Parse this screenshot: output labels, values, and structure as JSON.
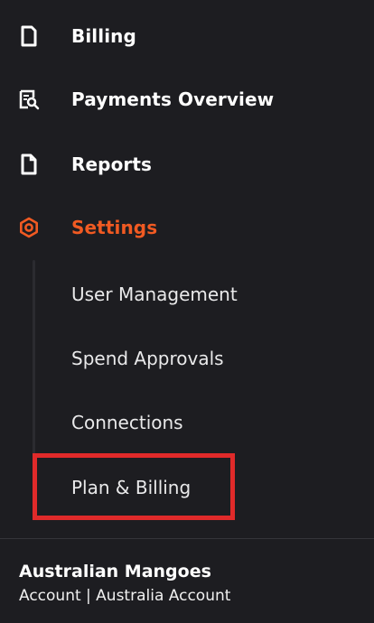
{
  "colors": {
    "background": "#1d1d21",
    "active_accent": "#f15a22",
    "highlight_box": "#e02a2a",
    "text": "#ffffff"
  },
  "nav": {
    "items": [
      {
        "label": "Billing",
        "icon": "document-icon",
        "active": false
      },
      {
        "label": "Payments Overview",
        "icon": "search-document-icon",
        "active": false
      },
      {
        "label": "Reports",
        "icon": "file-icon",
        "active": false
      },
      {
        "label": "Settings",
        "icon": "gear-icon",
        "active": true
      }
    ]
  },
  "settings_submenu": {
    "items": [
      {
        "label": "User Management"
      },
      {
        "label": "Spend Approvals"
      },
      {
        "label": "Connections"
      },
      {
        "label": "Plan & Billing",
        "highlighted": true
      }
    ]
  },
  "account": {
    "name": "Australian Mangoes",
    "subtitle": "Account | Australia Account"
  }
}
